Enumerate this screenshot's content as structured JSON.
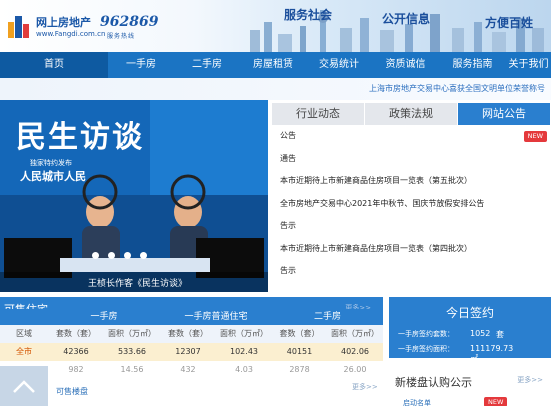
{
  "header": {
    "logo_title": "网上房地产",
    "logo_url": "www.Fangdi.com.cn",
    "hotline": "962869",
    "hotline_sub": "服务热线",
    "slogans": [
      "服务社会",
      "公开信息",
      "方便百姓"
    ]
  },
  "nav": {
    "items": [
      {
        "label": "首页",
        "active": true
      },
      {
        "label": "一手房",
        "active": false
      },
      {
        "label": "二手房",
        "active": false
      },
      {
        "label": "房屋租赁",
        "active": false
      },
      {
        "label": "交易统计",
        "active": false
      },
      {
        "label": "资质诚信",
        "active": false
      },
      {
        "label": "服务指南",
        "active": false
      },
      {
        "label": "关于我们",
        "active": false
      }
    ]
  },
  "honor_text": "上海市房地产交易中心喜获全国文明单位荣誉称号",
  "video": {
    "title": "民生访谈",
    "guest_note": "独家特约发布",
    "host": "人民城市人民",
    "caption": "王桢长作客《民生访谈》",
    "slide_count": 4
  },
  "news_tabs": [
    {
      "label": "行业动态",
      "active": false
    },
    {
      "label": "政策法规",
      "active": false
    },
    {
      "label": "网站公告",
      "active": true
    }
  ],
  "news_items": [
    {
      "text": "公告",
      "badge": "NEW"
    },
    {
      "text": "通告",
      "badge": ""
    },
    {
      "text": "本市近期待上市新建商品住房项目一览表（第五批次）",
      "badge": ""
    },
    {
      "text": "全市房地产交易中心2021年中秋节、国庆节放假安排公告",
      "badge": ""
    },
    {
      "text": "告示",
      "badge": ""
    },
    {
      "text": "本市近期待上市新建商品住房项目一览表（第四批次）",
      "badge": ""
    },
    {
      "text": "告示",
      "badge": ""
    }
  ],
  "trade": {
    "title": "可售住宅",
    "more": "更多>>",
    "groups": [
      "一手房",
      "一手房普通住宅",
      "二手房"
    ],
    "columns": [
      "区域",
      "套数（套）",
      "面积（万㎡）",
      "套数（套）",
      "面积（万㎡）",
      "套数（套）",
      "面积（万㎡）"
    ],
    "rows": [
      [
        "全市",
        "42366",
        "533.66",
        "12307",
        "102.43",
        "40151",
        "402.06"
      ],
      [
        "",
        "982",
        "14.56",
        "432",
        "4.03",
        "2878",
        "26.00"
      ]
    ],
    "sub_link": "可售楼盘",
    "sub_more": "更多>>"
  },
  "today": {
    "title": "今日签约",
    "line1_label": "一手房签约套数：",
    "line1_value": "1052",
    "line1_unit": "套",
    "line2_label": "一手房签约面积：",
    "line2_value": "111179.73㎡"
  },
  "new_disc": {
    "title": "新楼盘认购公示",
    "more": "更多>>",
    "item": "启动名单",
    "badge": "NEW"
  },
  "colors": {
    "nav_blue": "#1b74c3",
    "tab_active": "#2a7fcf",
    "badge_red": "#e4393c",
    "highlight_row": "#fbefd0"
  }
}
